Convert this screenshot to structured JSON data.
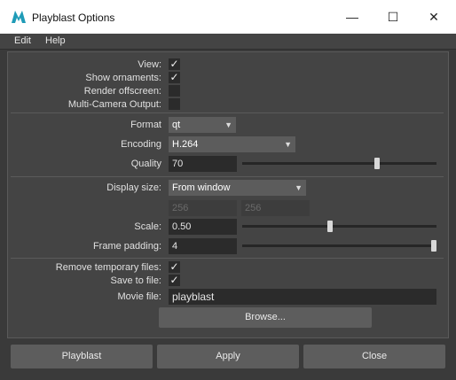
{
  "window": {
    "title": "Playblast Options",
    "minimize": "—",
    "maximize": "☐",
    "close": "✕"
  },
  "menu": {
    "edit": "Edit",
    "help": "Help"
  },
  "options": {
    "view_label": "View:",
    "show_ornaments_label": "Show ornaments:",
    "render_offscreen_label": "Render offscreen:",
    "multi_camera_label": "Multi-Camera Output:",
    "view_checked": "✓",
    "ornaments_checked": "✓"
  },
  "format": {
    "format_label": "Format",
    "format_value": "qt",
    "encoding_label": "Encoding",
    "encoding_value": "H.264",
    "quality_label": "Quality",
    "quality_value": "70",
    "quality_fraction": 0.7
  },
  "display": {
    "display_size_label": "Display size:",
    "display_size_value": "From window",
    "width_value": "256",
    "height_value": "256",
    "scale_label": "Scale:",
    "scale_value": "0.50",
    "scale_fraction": 0.45,
    "frame_padding_label": "Frame padding:",
    "frame_padding_value": "4",
    "frame_padding_fraction": 1.0
  },
  "output": {
    "remove_temp_label": "Remove temporary files:",
    "remove_temp_checked": "✓",
    "save_to_file_label": "Save to file:",
    "save_to_file_checked": "✓",
    "movie_file_label": "Movie file:",
    "movie_file_value": "playblast",
    "browse_label": "Browse..."
  },
  "buttons": {
    "playblast": "Playblast",
    "apply": "Apply",
    "close": "Close"
  },
  "colors": {
    "accent": "#1f9bb7",
    "background": "#444444",
    "field": "#2b2b2b"
  }
}
